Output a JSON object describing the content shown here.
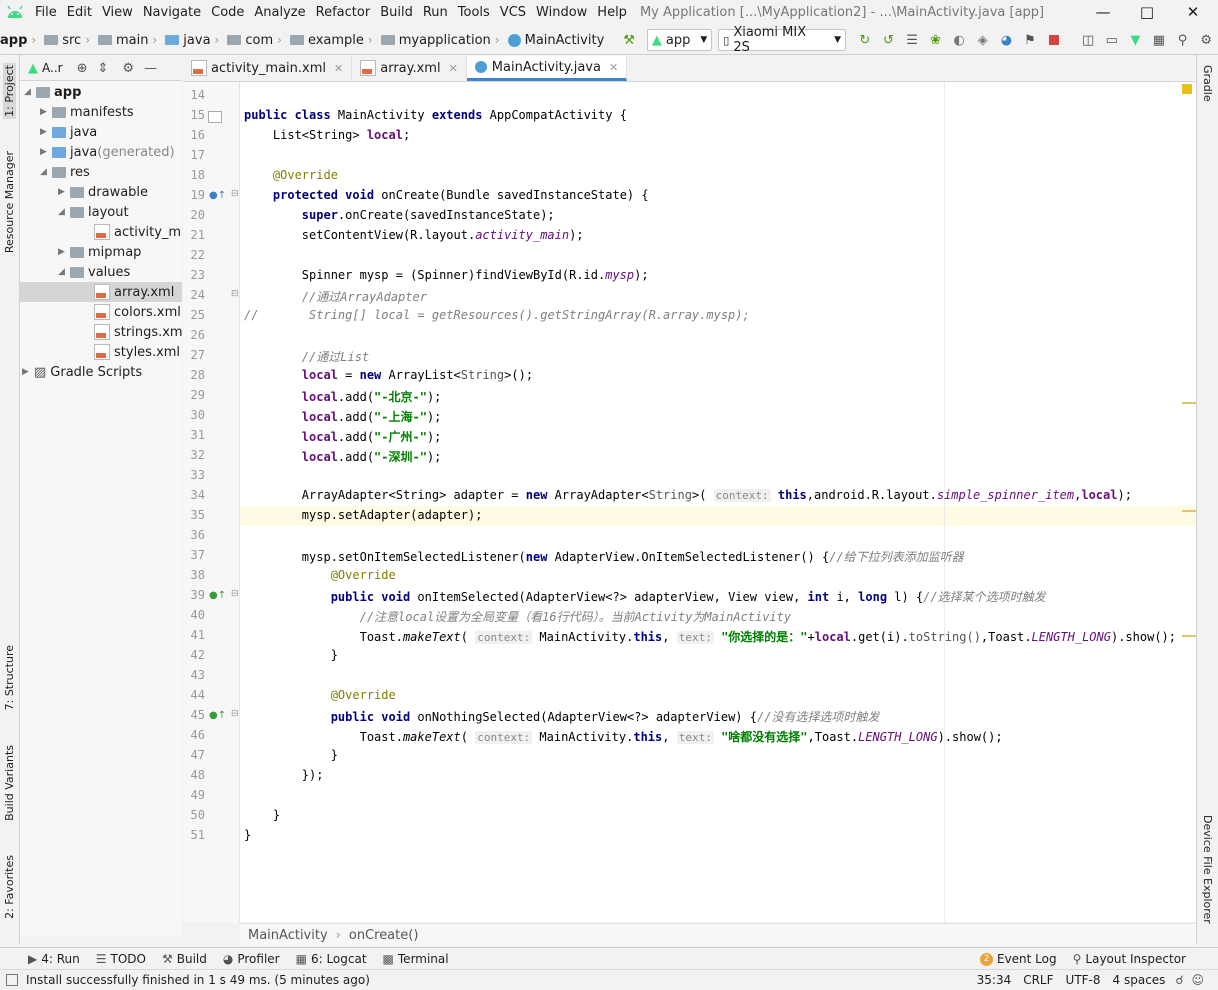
{
  "menu": {
    "items": [
      "File",
      "Edit",
      "View",
      "Navigate",
      "Code",
      "Analyze",
      "Refactor",
      "Build",
      "Run",
      "Tools",
      "VCS",
      "Window",
      "Help"
    ],
    "window_title": "My Application [...\\MyApplication2] - ...\\MainActivity.java [app]"
  },
  "toolbar": {
    "breadcrumbs": [
      "app",
      "src",
      "main",
      "java",
      "com",
      "example",
      "myapplication",
      "MainActivity"
    ],
    "run_config": "app",
    "device": "Xiaomi MIX 2S"
  },
  "left_strip": {
    "project": "1: Project",
    "resource_manager": "Resource Manager",
    "structure": "7: Structure",
    "build_variants": "Build Variants",
    "favorites": "2: Favorites"
  },
  "right_strip": {
    "gradle": "Gradle",
    "device_explorer": "Device File Explorer"
  },
  "project_panel": {
    "view_label": "A..r"
  },
  "tree": [
    {
      "label": "app",
      "bold": true
    },
    {
      "label": "manifests"
    },
    {
      "label": "java"
    },
    {
      "label": "java",
      "suffix": " (generated)"
    },
    {
      "label": "res"
    },
    {
      "label": "drawable"
    },
    {
      "label": "layout"
    },
    {
      "label": "activity_main"
    },
    {
      "label": "mipmap"
    },
    {
      "label": "values"
    },
    {
      "label": "array.xml",
      "selected": true
    },
    {
      "label": "colors.xml"
    },
    {
      "label": "strings.xml"
    },
    {
      "label": "styles.xml"
    },
    {
      "label": "Gradle Scripts"
    }
  ],
  "tabs": [
    {
      "label": "activity_main.xml"
    },
    {
      "label": "array.xml"
    },
    {
      "label": "MainActivity.java",
      "active": true
    }
  ],
  "code_lines": {
    "numbers": [
      "14",
      "15",
      "16",
      "17",
      "18",
      "19",
      "20",
      "21",
      "22",
      "23",
      "24",
      "25",
      "26",
      "27",
      "28",
      "29",
      "30",
      "31",
      "32",
      "33",
      "34",
      "35",
      "36",
      "37",
      "38",
      "39",
      "40",
      "41",
      "42",
      "43",
      "44",
      "45",
      "46",
      "47",
      "48",
      "49",
      "50",
      "51"
    ],
    "comment_arrayadapter": "//通过ArrayAdapter",
    "comment_getres": "String[] local = getResources().getStringArray(R.array.mysp);",
    "comment_list": "//通过List",
    "str_beijing": "\"-北京-\"",
    "str_shanghai": "\"-上海-\"",
    "str_guangzhou": "\"-广州-\"",
    "str_shenzhen": "\"-深圳-\"",
    "comment_listener": "//给下拉列表添加监听器",
    "comment_selected": "//选择某个选项时触发",
    "comment_note": "//注意local设置为全局变量（看16行代码）。当前Activity为MainActivity",
    "str_choice": "\"你选择的是：\"",
    "comment_nothing": "//没有选择选项时触发",
    "str_nothing": "\"啥都没有选择\"",
    "hint_context": "context:",
    "hint_text": "text:"
  },
  "editor_breadcrumb": [
    "MainActivity",
    "onCreate()"
  ],
  "bottom_tools": [
    "4: Run",
    "TODO",
    "Build",
    "Profiler",
    "6: Logcat",
    "Terminal"
  ],
  "bottom_right": {
    "event_log": "Event Log",
    "event_count": "2",
    "layout_inspector": "Layout Inspector"
  },
  "status": {
    "message": "Install successfully finished in 1 s 49 ms. (5 minutes ago)",
    "position": "35:34",
    "line_sep": "CRLF",
    "encoding": "UTF-8",
    "indent": "4 spaces"
  },
  "colors": {
    "keyword": "#000080",
    "string": "#008000",
    "comment": "#808080",
    "annotation": "#808000",
    "field": "#660e7a",
    "current_line": "#fffae3",
    "tab_accent": "#4083c9"
  }
}
